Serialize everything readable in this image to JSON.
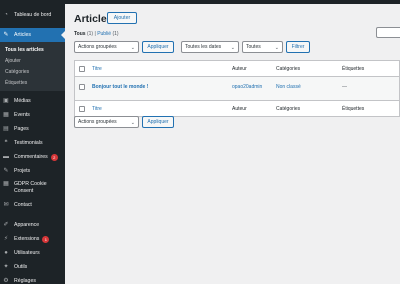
{
  "sidebar": {
    "dashboard": "Tableau de bord",
    "articles": "Articles",
    "articles_sub": [
      "Tous les articles",
      "Ajouter",
      "Catégories",
      "Étiquettes"
    ],
    "items": [
      {
        "label": "Médias",
        "icon": "media-icon"
      },
      {
        "label": "Events",
        "icon": "calendar-icon"
      },
      {
        "label": "Pages",
        "icon": "pages-icon"
      },
      {
        "label": "Testimonials",
        "icon": "testimonial-icon"
      },
      {
        "label": "Commentaires",
        "icon": "comments-icon",
        "badge": "2"
      },
      {
        "label": "Projets",
        "icon": "projects-icon"
      },
      {
        "label": "GDPR Cookie Consent",
        "icon": "cookie-icon"
      },
      {
        "label": "Contact",
        "icon": "contact-icon"
      },
      {
        "label": "Apparence",
        "icon": "appearance-icon"
      },
      {
        "label": "Extensions",
        "icon": "plugins-icon",
        "badge": "1"
      },
      {
        "label": "Utilisateurs",
        "icon": "users-icon"
      },
      {
        "label": "Outils",
        "icon": "tools-icon"
      },
      {
        "label": "Réglages",
        "icon": "settings-icon"
      }
    ]
  },
  "header": {
    "title": "Articles",
    "add_button": "Ajouter"
  },
  "filters": {
    "all_label": "Tous",
    "all_count": "(1)",
    "separator": "|",
    "published_label": "Publié",
    "published_count": "(1)"
  },
  "toolbar_top": {
    "bulk_actions": "Actions groupées",
    "apply": "Appliquer",
    "dates": "Toutes les dates",
    "categories": "Toutes",
    "filter": "Filtrer"
  },
  "table": {
    "headers": {
      "title": "Titre",
      "author": "Auteur",
      "categories": "Catégories",
      "tags": "Étiquettes"
    },
    "rows": [
      {
        "title": "Bonjour tout le monde !",
        "author": "opao20admin",
        "category": "Non classé",
        "tags": "—"
      }
    ]
  },
  "toolbar_bottom": {
    "bulk_actions": "Actions groupées",
    "apply": "Appliquer"
  },
  "colors": {
    "sidebar_bg": "#1d2327",
    "accent": "#2271b1",
    "badge": "#d63638"
  }
}
